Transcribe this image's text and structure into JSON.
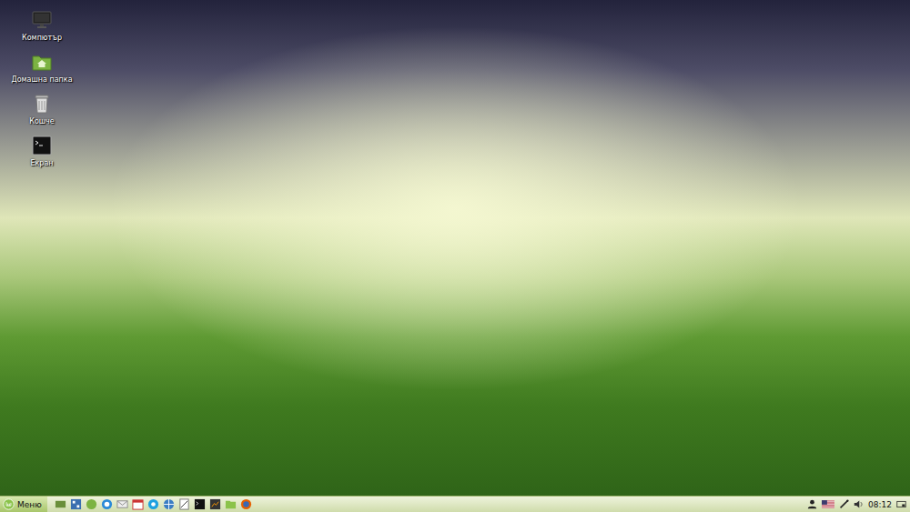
{
  "desktop": {
    "icons": [
      {
        "label": "Компютър",
        "kind": "computer"
      },
      {
        "label": "Домашна папка",
        "kind": "home"
      },
      {
        "label": "Кошче",
        "kind": "trash"
      },
      {
        "label": "Екран",
        "kind": "terminal"
      }
    ]
  },
  "panel": {
    "menu": {
      "label": "Меню"
    },
    "clock": "08:12"
  }
}
